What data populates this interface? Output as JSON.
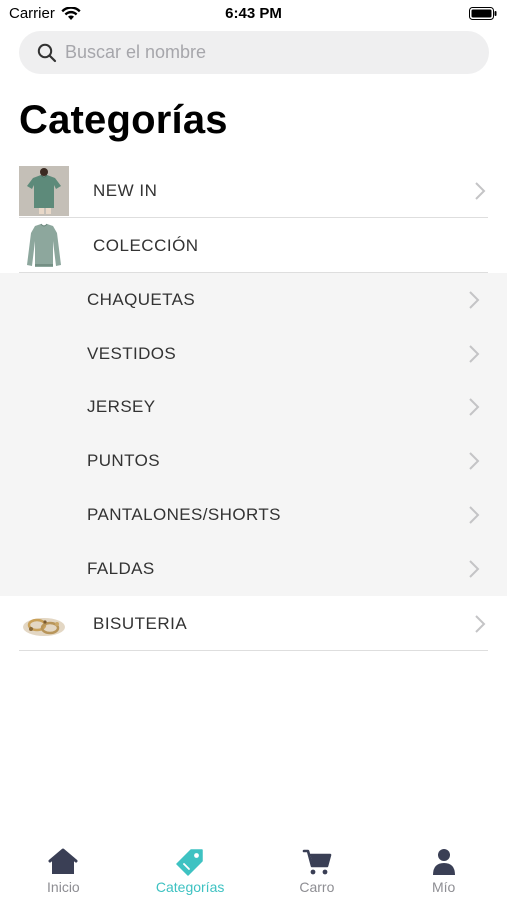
{
  "status_bar": {
    "carrier": "Carrier",
    "time": "6:43 PM"
  },
  "search": {
    "placeholder": "Buscar el nombre"
  },
  "page_title": "Categorías",
  "categories": [
    {
      "label": "NEW IN",
      "icon": "green-tshirt-thumbnail"
    },
    {
      "label": "COLECCIÓN",
      "icon": "sweater-thumbnail"
    },
    {
      "label": "BISUTERIA",
      "icon": "jewelry-thumbnail"
    }
  ],
  "subcategories": [
    {
      "label": "CHAQUETAS"
    },
    {
      "label": "VESTIDOS"
    },
    {
      "label": "JERSEY"
    },
    {
      "label": "PUNTOS"
    },
    {
      "label": "PANTALONES/SHORTS"
    },
    {
      "label": "FALDAS"
    }
  ],
  "tabs": [
    {
      "label": "Inicio",
      "icon": "home-icon"
    },
    {
      "label": "Categorías",
      "icon": "tag-icon",
      "active": true
    },
    {
      "label": "Carro",
      "icon": "cart-icon"
    },
    {
      "label": "Mío",
      "icon": "user-icon"
    }
  ],
  "colors": {
    "accent": "#3ec2c2",
    "inactive_tab": "#8e8e93",
    "icon_dark": "#3a3f55",
    "sublist_bg": "#f5f5f5"
  }
}
